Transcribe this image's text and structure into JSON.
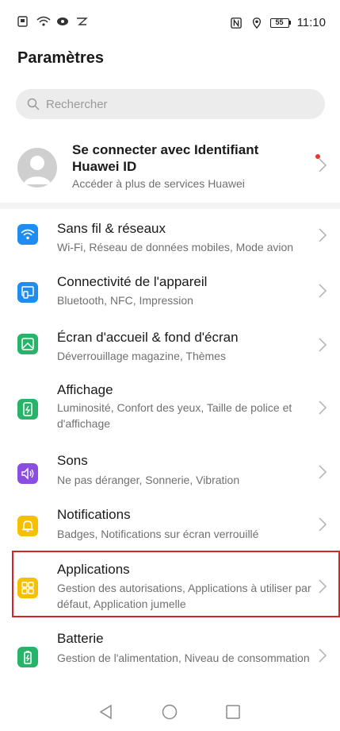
{
  "status": {
    "time": "11:10",
    "battery": "55"
  },
  "page": {
    "title": "Paramètres"
  },
  "search": {
    "placeholder": "Rechercher"
  },
  "account": {
    "title": "Se connecter avec Identifiant Huawei ID",
    "subtitle": "Accéder à plus de services Huawei"
  },
  "items": [
    {
      "title": "Sans fil & réseaux",
      "subtitle": "Wi-Fi, Réseau de données mobiles, Mode avion",
      "color": "#1e8cf0",
      "icon": "wifi-icon"
    },
    {
      "title": "Connectivité de l'appareil",
      "subtitle": "Bluetooth, NFC, Impression",
      "color": "#1e8cf0",
      "icon": "device-connectivity-icon"
    },
    {
      "title": "Écran d'accueil & fond d'écran",
      "subtitle": "Déverrouillage magazine, Thèmes",
      "color": "#27b36a",
      "icon": "wallpaper-icon"
    },
    {
      "title": "Affichage",
      "subtitle": "Luminosité, Confort des yeux, Taille de police et d'affichage",
      "color": "#27b36a",
      "icon": "display-icon"
    },
    {
      "title": "Sons",
      "subtitle": "Ne pas déranger, Sonnerie, Vibration",
      "color": "#8a4fe0",
      "icon": "sound-icon"
    },
    {
      "title": "Notifications",
      "subtitle": "Badges, Notifications sur écran verrouillé",
      "color": "#f5c000",
      "icon": "bell-icon"
    },
    {
      "title": "Applications",
      "subtitle": "Gestion des autorisations, Applications à utiliser par défaut, Application jumelle",
      "color": "#f5c000",
      "icon": "apps-icon"
    },
    {
      "title": "Batterie",
      "subtitle": "Gestion de l'alimentation, Niveau de consommation",
      "color": "#27b36a",
      "icon": "battery-icon"
    }
  ]
}
